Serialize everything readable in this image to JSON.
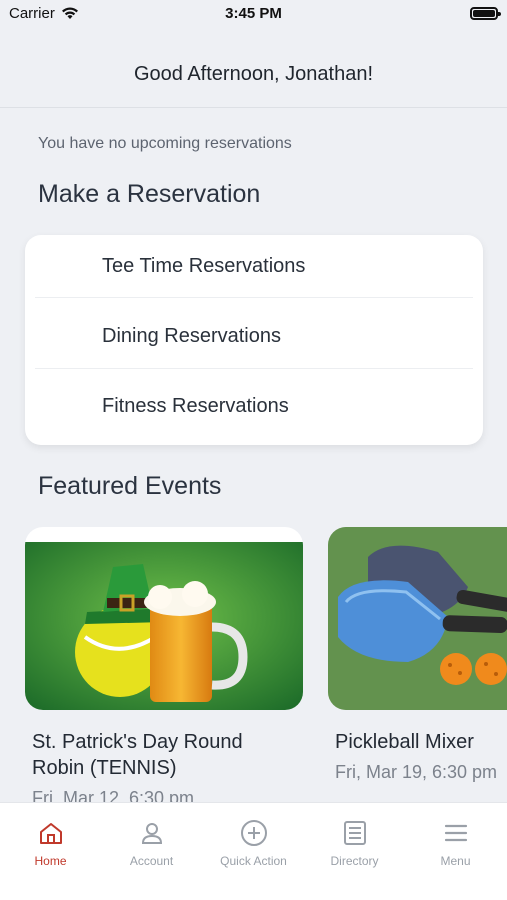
{
  "status_bar": {
    "carrier": "Carrier",
    "time": "3:45 PM"
  },
  "header": {
    "greeting": "Good Afternoon, Jonathan!"
  },
  "upcoming": {
    "message": "You have no upcoming reservations"
  },
  "reservations": {
    "title": "Make a Reservation",
    "items": [
      {
        "label": "Tee Time Reservations"
      },
      {
        "label": "Dining Reservations"
      },
      {
        "label": "Fitness Reservations"
      }
    ]
  },
  "featured": {
    "title": "Featured Events",
    "events": [
      {
        "title_line1": "St. Patrick's Day Round",
        "title_line2": "Robin (TENNIS)",
        "date": "Fri, Mar 12, 6:30 pm",
        "image": "st-patricks-tennis-beer"
      },
      {
        "title_line1": "Pickleball Mixer",
        "date": "Fri, Mar 19, 6:30 pm",
        "image": "pickleball-paddles"
      }
    ]
  },
  "tabs": [
    {
      "label": "Home",
      "icon": "home-icon",
      "active": true
    },
    {
      "label": "Account",
      "icon": "account-icon"
    },
    {
      "label": "Quick Action",
      "icon": "plus-circle-icon"
    },
    {
      "label": "Directory",
      "icon": "directory-icon"
    },
    {
      "label": "Menu",
      "icon": "menu-icon"
    }
  ],
  "colors": {
    "active_tab": "#c0392b",
    "inactive_tab": "#9aa0a8",
    "background": "#eef0f4"
  }
}
